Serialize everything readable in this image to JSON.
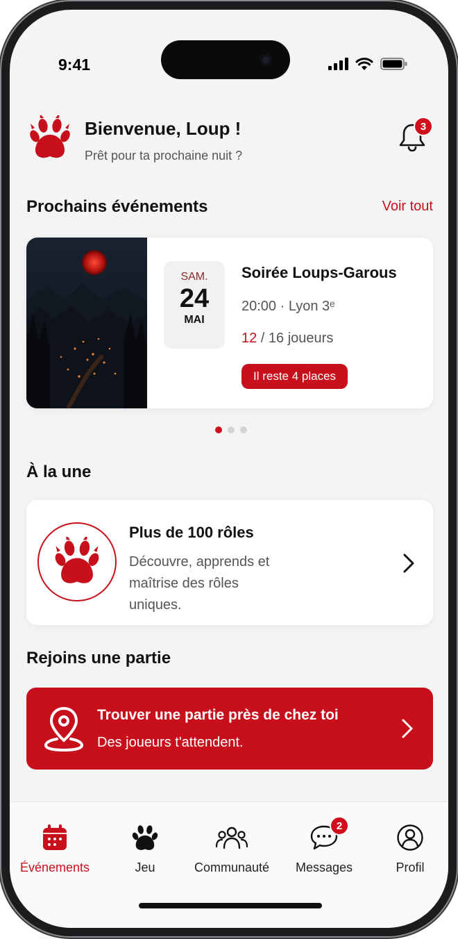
{
  "status_bar": {
    "time": "9:41"
  },
  "header": {
    "title": "Bienvenue, Loup !",
    "subtitle": "Prêt pour ta prochaine nuit ?",
    "notification_count": "3"
  },
  "events_section": {
    "title": "Prochains événements",
    "see_all": "Voir tout",
    "event": {
      "day_name": "SAM.",
      "day_number": "24",
      "month": "MAI",
      "title": "Soirée Loups-Garous",
      "meta": "20:00 · Lyon 3ᵉ",
      "players_current": "12",
      "players_rest": " / 16 joueurs",
      "places_left": "Il reste 4 places"
    },
    "carousel": {
      "active_index": 0,
      "count": 3
    }
  },
  "featured_section": {
    "title": "À la une",
    "card": {
      "title": "Plus de 100 rôles",
      "description": "Découvre, apprends et maîtrise des rôles uniques."
    }
  },
  "join_section": {
    "title": "Rejoins une partie",
    "cta": {
      "title": "Trouver une partie près de chez toi",
      "subtitle": "Des joueurs t'attendent."
    }
  },
  "tab_bar": {
    "tabs": [
      {
        "label": "Événements",
        "icon": "calendar-icon",
        "active": true
      },
      {
        "label": "Jeu",
        "icon": "paw-icon"
      },
      {
        "label": "Communauté",
        "icon": "community-icon"
      },
      {
        "label": "Messages",
        "icon": "chat-icon",
        "badge": "2"
      },
      {
        "label": "Profil",
        "icon": "profile-icon"
      }
    ]
  },
  "colors": {
    "accent": "#c8101c",
    "background": "#f4f4f4",
    "card": "#ffffff"
  }
}
